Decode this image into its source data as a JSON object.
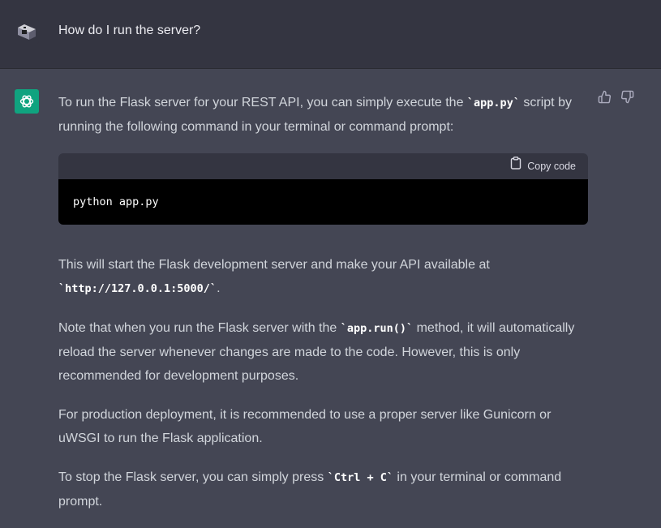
{
  "conversation": {
    "user_message": "How do I run the server?",
    "assistant": {
      "para1": {
        "pre": "To run the Flask server for your REST API, you can simply execute the ",
        "code": "`app.py`",
        "post": " script by running the following command in your terminal or command prompt:"
      },
      "code_block": {
        "copy_label": "Copy code",
        "code": "python app.py"
      },
      "para2": {
        "pre": "This will start the Flask development server and make your API available at ",
        "code": "`http://127.0.0.1:5000/`",
        "post": "."
      },
      "para3": {
        "pre": "Note that when you run the Flask server with the ",
        "code": "`app.run()`",
        "post": " method, it will automatically reload the server whenever changes are made to the code. However, this is only recommended for development purposes."
      },
      "para4": "For production deployment, it is recommended to use a proper server like Gunicorn or uWSGI to run the Flask application.",
      "para5": {
        "pre": "To stop the Flask server, you can simply press ",
        "code": "`Ctrl + C`",
        "post": " in your terminal or command prompt."
      }
    }
  },
  "icons": {
    "user_avatar": "user-avatar-icon",
    "assistant_avatar": "openai-logo-icon",
    "copy": "clipboard-icon",
    "thumbs_up": "thumbs-up-icon",
    "thumbs_down": "thumbs-down-icon"
  },
  "colors": {
    "page_bg": "#444654",
    "user_row_bg": "#343541",
    "assistant_avatar_bg": "#10a37f",
    "code_bg": "#000000",
    "code_header_bg": "#343541"
  }
}
